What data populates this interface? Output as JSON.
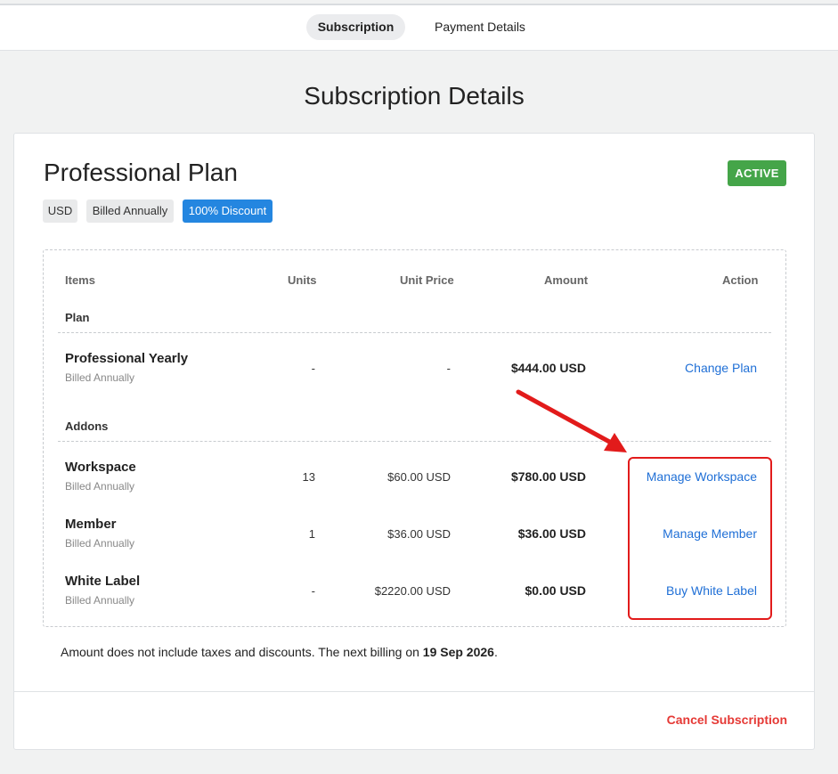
{
  "tabs": [
    {
      "label": "Subscription",
      "active": true
    },
    {
      "label": "Payment Details",
      "active": false
    }
  ],
  "page_title": "Subscription Details",
  "plan": {
    "name": "Professional Plan",
    "status": "ACTIVE",
    "chips": {
      "currency": "USD",
      "billing": "Billed Annually",
      "discount": "100% Discount"
    }
  },
  "table": {
    "headers": {
      "items": "Items",
      "units": "Units",
      "unit_price": "Unit Price",
      "amount": "Amount",
      "action": "Action"
    },
    "sections": {
      "plan": "Plan",
      "addons": "Addons"
    },
    "rows": [
      {
        "name": "Professional Yearly",
        "sub": "Billed Annually",
        "units": "-",
        "unit_price": "-",
        "amount": "$444.00 USD",
        "action": "Change Plan"
      },
      {
        "name": "Workspace",
        "sub": "Billed Annually",
        "units": "13",
        "unit_price": "$60.00 USD",
        "amount": "$780.00 USD",
        "action": "Manage Workspace"
      },
      {
        "name": "Member",
        "sub": "Billed Annually",
        "units": "1",
        "unit_price": "$36.00 USD",
        "amount": "$36.00 USD",
        "action": "Manage Member"
      },
      {
        "name": "White Label",
        "sub": "Billed Annually",
        "units": "-",
        "unit_price": "$2220.00 USD",
        "amount": "$0.00 USD",
        "action": "Buy White Label"
      }
    ]
  },
  "note": {
    "text": "Amount does not include taxes and discounts. The next billing on ",
    "date": "19 Sep 2026",
    "end": "."
  },
  "footer": {
    "cancel_label": "Cancel Subscription"
  },
  "colors": {
    "active_badge": "#45a549",
    "discount_chip": "#2486e0",
    "link": "#1f6fd6",
    "cancel": "#e53935",
    "annotation": "#e21b1b"
  }
}
